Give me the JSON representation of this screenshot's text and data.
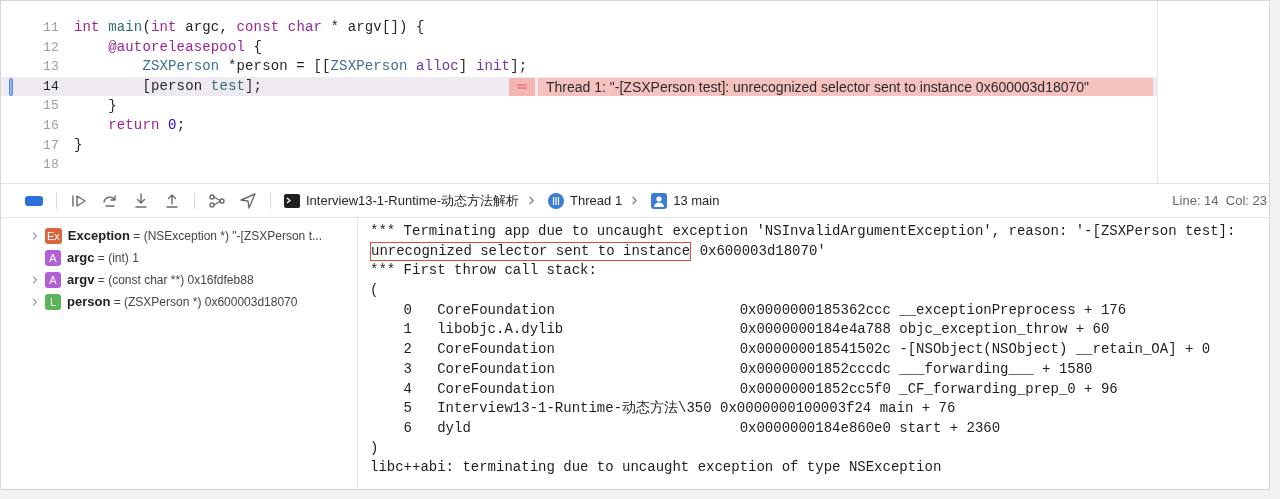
{
  "editor": {
    "lines": [
      {
        "number": "11",
        "current": false,
        "tokens": [
          {
            "text": "int",
            "kind": "keyword"
          },
          {
            "text": " main",
            "kind": "func"
          },
          {
            "text": "(",
            "kind": "plain"
          },
          {
            "text": "int",
            "kind": "keyword"
          },
          {
            "text": " argc, ",
            "kind": "plain"
          },
          {
            "text": "const",
            "kind": "keyword"
          },
          {
            "text": " char",
            "kind": "keyword"
          },
          {
            "text": " * argv[]) {",
            "kind": "plain"
          }
        ]
      },
      {
        "number": "12",
        "current": false,
        "tokens": [
          {
            "text": "    @autoreleasepool",
            "kind": "keyword"
          },
          {
            "text": " {",
            "kind": "plain"
          }
        ]
      },
      {
        "number": "13",
        "current": false,
        "tokens": [
          {
            "text": "        ZSXPerson",
            "kind": "type"
          },
          {
            "text": " *person = [[",
            "kind": "plain"
          },
          {
            "text": "ZSXPerson",
            "kind": "type"
          },
          {
            "text": " alloc",
            "kind": "method"
          },
          {
            "text": "] ",
            "kind": "plain"
          },
          {
            "text": "init",
            "kind": "method"
          },
          {
            "text": "];",
            "kind": "plain"
          }
        ]
      },
      {
        "number": "14",
        "current": true,
        "tokens": [
          {
            "text": "        [person ",
            "kind": "plain"
          },
          {
            "text": "test",
            "kind": "func"
          },
          {
            "text": "];",
            "kind": "plain"
          }
        ],
        "error": "Thread 1: \"-[ZSXPerson test]: unrecognized selector sent to instance 0x600003d18070\""
      },
      {
        "number": "15",
        "current": false,
        "tokens": [
          {
            "text": "    }",
            "kind": "plain"
          }
        ]
      },
      {
        "number": "16",
        "current": false,
        "tokens": [
          {
            "text": "    return",
            "kind": "keyword"
          },
          {
            "text": " 0",
            "kind": "number"
          },
          {
            "text": ";",
            "kind": "plain"
          }
        ]
      },
      {
        "number": "17",
        "current": false,
        "tokens": [
          {
            "text": "}",
            "kind": "plain"
          }
        ]
      },
      {
        "number": "18",
        "current": false
      }
    ]
  },
  "debug_bar": {
    "breakpoints_on": true,
    "breadcrumb": [
      {
        "kind": "target",
        "label": "Interview13-1-Runtime-动态方法解析"
      },
      {
        "kind": "thread",
        "label": "Thread 1"
      },
      {
        "kind": "frame",
        "label": "13 main"
      }
    ],
    "position": "Line: 14  Col: 23"
  },
  "variables": [
    {
      "badge": "Ex",
      "color": "#d9653b",
      "name": "Exception",
      "value": " = (NSException *) \"-[ZSXPerson t...",
      "expandable": true
    },
    {
      "badge": "A",
      "color": "#b35fd6",
      "name": "argc",
      "value": " = (int) 1",
      "expandable": false
    },
    {
      "badge": "A",
      "color": "#b35fd6",
      "name": "argv",
      "value": " = (const char **) 0x16fdfeb88",
      "expandable": true
    },
    {
      "badge": "L",
      "color": "#5bb35a",
      "name": "person",
      "value": " = (ZSXPerson *) 0x600003d18070",
      "expandable": true
    }
  ],
  "console": {
    "lines": [
      [
        {
          "text": "*** Terminating app due to uncaught exception 'NSInvalidArgumentException', reason: '-[ZSXPerson test]:",
          "boxed": false
        }
      ],
      [
        {
          "text": "unrecognized selector sent to instance",
          "boxed": true
        },
        {
          "text": " 0x600003d18070'",
          "boxed": false
        }
      ],
      [
        {
          "text": "*** First throw call stack:",
          "boxed": false
        }
      ],
      [
        {
          "text": "(",
          "boxed": false
        }
      ],
      [
        {
          "text": "    0   CoreFoundation                      0x0000000185362ccc __exceptionPreprocess + 176",
          "boxed": false
        }
      ],
      [
        {
          "text": "    1   libobjc.A.dylib                     0x0000000184e4a788 objc_exception_throw + 60",
          "boxed": false
        }
      ],
      [
        {
          "text": "    2   CoreFoundation                      0x000000018541502c -[NSObject(NSObject) __retain_OA] + 0",
          "boxed": false
        }
      ],
      [
        {
          "text": "    3   CoreFoundation                      0x00000001852cccdc ___forwarding___ + 1580",
          "boxed": false
        }
      ],
      [
        {
          "text": "    4   CoreFoundation                      0x00000001852cc5f0 _CF_forwarding_prep_0 + 96",
          "boxed": false
        }
      ],
      [
        {
          "text": "    5   Interview13-1-Runtime-动态方法\\350 0x0000000100003f24 main + 76",
          "boxed": false
        }
      ],
      [
        {
          "text": "    6   dyld                                0x0000000184e860e0 start + 2360",
          "boxed": false
        }
      ],
      [
        {
          "text": ")",
          "boxed": false
        }
      ],
      [
        {
          "text": "libc++abi: terminating due to uncaught exception of type NSException",
          "boxed": false
        }
      ]
    ]
  }
}
